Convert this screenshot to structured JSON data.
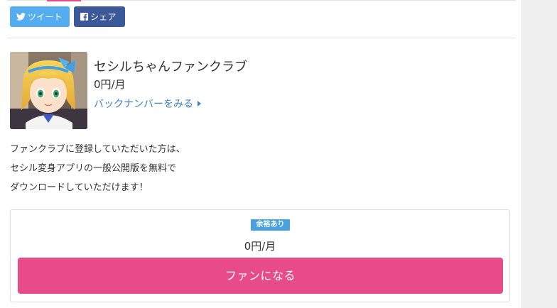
{
  "share": {
    "tweet_label": "ツイート",
    "facebook_label": "シェア",
    "twitter_color": "#55acee",
    "facebook_color": "#3b5998"
  },
  "club": {
    "name": "セシルちゃんファンクラブ",
    "price": "0円/月",
    "backnumber_link": "バックナンバーをみる"
  },
  "description": {
    "lines": [
      "ファンクラブに登録していただいた方は、",
      "セシル変身アプリの一般公開版を無料で",
      "ダウンロードしていただけます！"
    ]
  },
  "plan": {
    "availability_badge": "余裕あり",
    "price": "0円/月",
    "join_button": "ファンになる",
    "accent_color": "#e84c88",
    "badge_color": "#4aa1df"
  }
}
